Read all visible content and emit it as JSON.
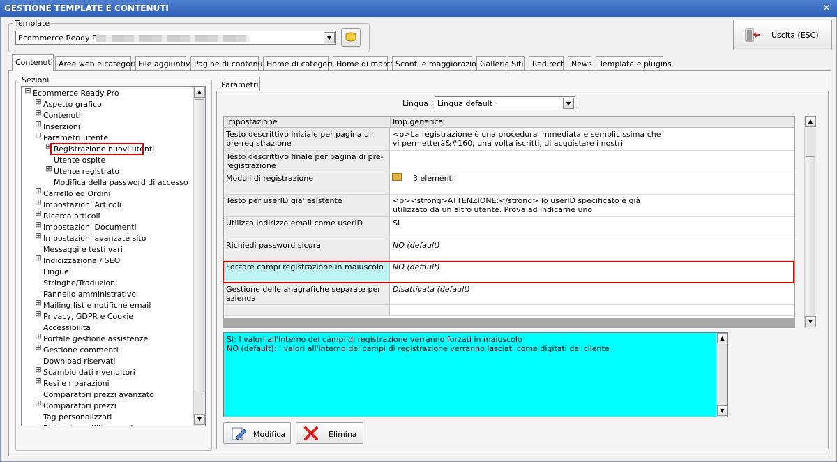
{
  "window": {
    "title": "GESTIONE TEMPLATE E CONTENUTI",
    "close_glyph": "✕"
  },
  "template_group": {
    "legend": "Template",
    "selected": "Ecommerce Ready Pro"
  },
  "exit_button": {
    "label": "Uscita (ESC)"
  },
  "tabs": [
    "Contenuti",
    "Aree web e categorie",
    "File aggiuntivi",
    "Pagine di contenuti",
    "Home di categoria",
    "Home di marca",
    "Sconti e maggiorazioni",
    "Gallerie",
    "Siti",
    "Redirect",
    "News",
    "Template e plugins"
  ],
  "sections": {
    "legend": "Sezioni",
    "items": [
      {
        "label": "Ecommerce Ready Pro",
        "level": 0,
        "exp": "⊟"
      },
      {
        "label": "Aspetto grafico",
        "level": 1,
        "exp": "⊞"
      },
      {
        "label": "Contenuti",
        "level": 1,
        "exp": "⊞"
      },
      {
        "label": "Inserzioni",
        "level": 1,
        "exp": "⊞"
      },
      {
        "label": "Parametri utente",
        "level": 1,
        "exp": "⊟"
      },
      {
        "label": "Registrazione nuovi utenti",
        "level": 2,
        "exp": "⊞"
      },
      {
        "label": "Utente ospite",
        "level": 2,
        "exp": ""
      },
      {
        "label": "Utente registrato",
        "level": 2,
        "exp": "⊞"
      },
      {
        "label": "Modifica della password di accesso",
        "level": 2,
        "exp": ""
      },
      {
        "label": "Carrello ed Ordini",
        "level": 1,
        "exp": "⊞"
      },
      {
        "label": "Impostazioni Articoli",
        "level": 1,
        "exp": "⊞"
      },
      {
        "label": "Ricerca articoli",
        "level": 1,
        "exp": "⊞"
      },
      {
        "label": "Impostazioni Documenti",
        "level": 1,
        "exp": "⊞"
      },
      {
        "label": "Impostazioni avanzate sito",
        "level": 1,
        "exp": "⊞"
      },
      {
        "label": "Messaggi e testi vari",
        "level": 1,
        "exp": ""
      },
      {
        "label": "Indicizzazione / SEO",
        "level": 1,
        "exp": "⊞"
      },
      {
        "label": "Lingue",
        "level": 1,
        "exp": ""
      },
      {
        "label": "Stringhe/Traduzioni",
        "level": 1,
        "exp": ""
      },
      {
        "label": "Pannello amministrativo",
        "level": 1,
        "exp": ""
      },
      {
        "label": "Mailing list e notifiche email",
        "level": 1,
        "exp": "⊞"
      },
      {
        "label": "Privacy, GDPR e Cookie",
        "level": 1,
        "exp": "⊞"
      },
      {
        "label": "Accessibilita",
        "level": 1,
        "exp": ""
      },
      {
        "label": "Portale gestione assistenze",
        "level": 1,
        "exp": "⊞"
      },
      {
        "label": "Gestione commenti",
        "level": 1,
        "exp": "⊞"
      },
      {
        "label": "Download riservati",
        "level": 1,
        "exp": ""
      },
      {
        "label": "Scambio dati rivenditori",
        "level": 1,
        "exp": "⊞"
      },
      {
        "label": "Resi e riparazioni",
        "level": 1,
        "exp": "⊞"
      },
      {
        "label": "Comparatori prezzi avanzato",
        "level": 1,
        "exp": ""
      },
      {
        "label": "Comparatori prezzi",
        "level": 1,
        "exp": "⊞"
      },
      {
        "label": "Tag personalizzati",
        "level": 1,
        "exp": ""
      },
      {
        "label": "Richiesta ... (filtro ... ...)",
        "level": 1,
        "exp": ""
      }
    ]
  },
  "params_tab": "Parametri",
  "lingua": {
    "label": "Lingua :",
    "value": "Lingua default"
  },
  "grid": {
    "headers": [
      "Impostazione",
      "Imp.generica"
    ],
    "rows": [
      {
        "name": "Testo descrittivo iniziale per pagina di pre-registrazione",
        "value": "<p>La registrazione è una procedura immediata e semplicissima che\nvi permetterà&#160; una volta iscritti, di acquistare i nostri",
        "italic": false
      },
      {
        "name": "Testo descrittivo finale per pagina di pre-registrazione",
        "value": "",
        "italic": false
      },
      {
        "name": "Moduli di registrazione",
        "value": "3 elementi",
        "italic": false
      },
      {
        "name": "Testo per userID gia' esistente",
        "value": "<p><strong>ATTENZIONE:</strong> lo userID specificato è già\nutilizzato da un altro utente. Prova ad indicarne uno",
        "italic": false
      },
      {
        "name": "Utilizza indirizzo email come userID",
        "value": "SI",
        "italic": false
      },
      {
        "name": "Richiedi password sicura",
        "value": "NO (default)",
        "italic": true
      },
      {
        "name": "Forzare campi registrazione in maiuscolo",
        "value": "NO (default)",
        "italic": true
      },
      {
        "name": "Gestione delle anagrafiche separate per azienda",
        "value": "Disattivata (default)",
        "italic": true
      },
      {
        "name": "",
        "value": "",
        "italic": false
      }
    ]
  },
  "description": "SI: I valori all'interno dei campi di registrazione verranno forzati in maiuscolo\nNO (default):  I valori all'interno dei campi di registrazione verranno lasciati come digitati dal cliente",
  "buttons": {
    "modifica": "Modifica",
    "elimina": "Elimina"
  },
  "colors": {
    "selected_row": "#bff5f5",
    "description_bg": "#00ffff",
    "highlight_box": "#e00000"
  }
}
